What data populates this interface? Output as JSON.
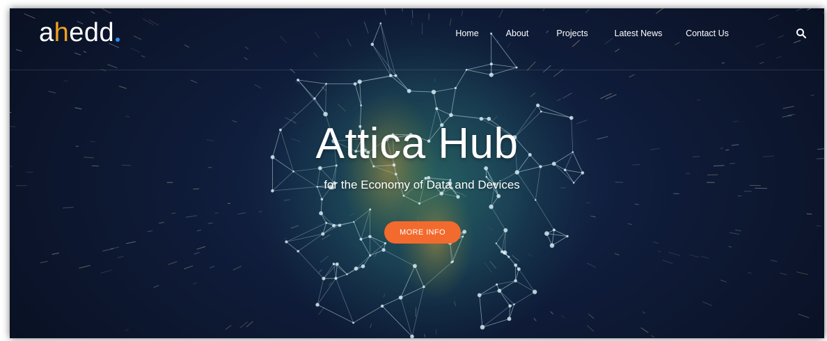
{
  "header": {
    "logo": {
      "part1": "a",
      "part2": "h",
      "part3": "edd"
    },
    "nav": [
      {
        "label": "Home"
      },
      {
        "label": "About"
      },
      {
        "label": "Projects"
      },
      {
        "label": "Latest News"
      },
      {
        "label": "Contact Us"
      }
    ]
  },
  "hero": {
    "title": "Attica Hub",
    "subtitle": "for the Economy of Data and Devices",
    "button_label": "MORE INFO"
  },
  "icons": {
    "search": "search-icon"
  },
  "colors": {
    "accent_button": "#f36a2e",
    "logo_orange": "#f0a020",
    "logo_blue": "#2f8ef0",
    "background_dark": "#0f1c3a"
  }
}
